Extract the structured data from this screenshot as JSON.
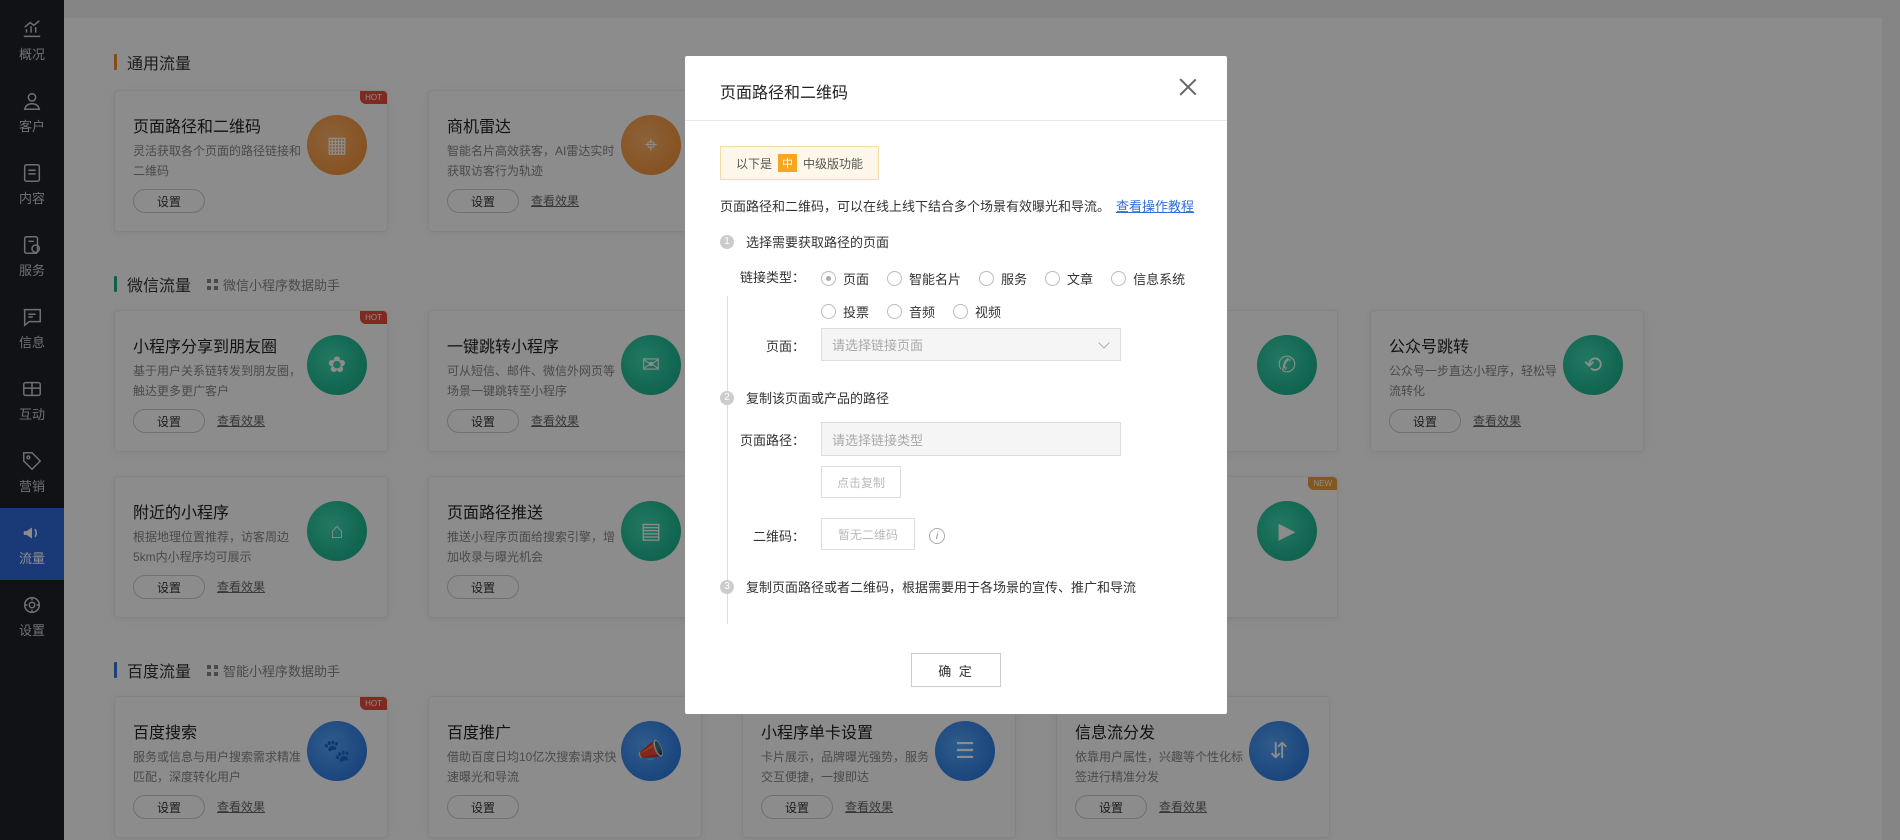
{
  "sidebar": {
    "items": [
      {
        "label": "概况",
        "icon": "chart-icon"
      },
      {
        "label": "客户",
        "icon": "user-icon"
      },
      {
        "label": "内容",
        "icon": "document-icon"
      },
      {
        "label": "服务",
        "icon": "service-icon"
      },
      {
        "label": "信息",
        "icon": "message-icon"
      },
      {
        "label": "互动",
        "icon": "interact-icon"
      },
      {
        "label": "营销",
        "icon": "tag-icon"
      },
      {
        "label": "流量",
        "icon": "megaphone-icon"
      },
      {
        "label": "设置",
        "icon": "gear-icon"
      }
    ],
    "active_index": 7
  },
  "sections": {
    "general": {
      "title": "通用流量"
    },
    "wechat": {
      "title": "微信流量",
      "helper": "微信小程序数据助手"
    },
    "baidu": {
      "title": "百度流量",
      "helper": "智能小程序数据助手"
    }
  },
  "cards": {
    "general": [
      {
        "title": "页面路径和二维码",
        "desc": "灵活获取各个页面的路径链接和二维码",
        "btn": "设置",
        "badge": "HOT"
      },
      {
        "title": "商机雷达",
        "desc": "智能名片高效获客，AI雷达实时获取访客行为轨迹",
        "btn": "设置",
        "link": "查看效果"
      }
    ],
    "wechat_row1": [
      {
        "title": "小程序分享到朋友圈",
        "desc": "基于用户关系链转发到朋友圈，触达更多更广客户",
        "btn": "设置",
        "link": "查看效果",
        "badge": "HOT"
      },
      {
        "title": "一键跳转小程序",
        "desc": "可从短信、邮件、微信外网页等场景一键跳转至小程序",
        "btn": "设置",
        "link": "查看效果"
      },
      {
        "title": "公众号跳转",
        "desc": "公众号一步直达小程序，轻松导流转化",
        "btn": "设置",
        "link": "查看效果"
      }
    ],
    "wechat_row2": [
      {
        "title": "附近的小程序",
        "desc": "根据地理位置推荐，访客周边5km内小程序均可展示",
        "btn": "设置",
        "link": "查看效果"
      },
      {
        "title": "页面路径推送",
        "desc": "推送小程序页面给搜索引擎，增加收录与曝光机会",
        "btn": "设置"
      },
      {
        "badge": "NEW"
      }
    ],
    "baidu": [
      {
        "title": "百度搜索",
        "desc": "服务或信息与用户搜索需求精准匹配，深度转化用户",
        "btn": "设置",
        "link": "查看效果",
        "badge": "HOT"
      },
      {
        "title": "百度推广",
        "desc": "借助百度日均10亿次搜索请求快速曝光和导流",
        "btn": "设置"
      },
      {
        "title": "小程序单卡设置",
        "desc": "卡片展示，品牌曝光强势，服务交互便捷，一搜即达",
        "btn": "设置",
        "link": "查看效果"
      },
      {
        "title": "信息流分发",
        "desc": "依靠用户属性，兴趣等个性化标签进行精准分发",
        "btn": "设置",
        "link": "查看效果"
      }
    ]
  },
  "modal": {
    "title": "页面路径和二维码",
    "tip_prefix": "以下是",
    "tip_level": "中",
    "tip_suffix": "中级版功能",
    "intro": "页面路径和二维码，可以在线上线下结合多个场景有效曝光和导流。",
    "intro_link": "查看操作教程",
    "steps": [
      {
        "num": "1",
        "text": "选择需要获取路径的页面"
      },
      {
        "num": "2",
        "text": "复制该页面或产品的路径"
      },
      {
        "num": "3",
        "text": "复制页面路径或者二维码，根据需要用于各场景的宣传、推广和导流"
      }
    ],
    "link_type_label": "链接类型：",
    "link_types": [
      "页面",
      "智能名片",
      "服务",
      "文章",
      "信息系统",
      "投票",
      "音频",
      "视频"
    ],
    "selected_link_type": "页面",
    "page_label": "页面：",
    "page_placeholder": "请选择链接页面",
    "path_label": "页面路径：",
    "path_placeholder": "请选择链接类型",
    "copy_btn": "点击复制",
    "qrcode_label": "二维码：",
    "qrcode_btn": "暂无二维码",
    "confirm": "确 定"
  }
}
